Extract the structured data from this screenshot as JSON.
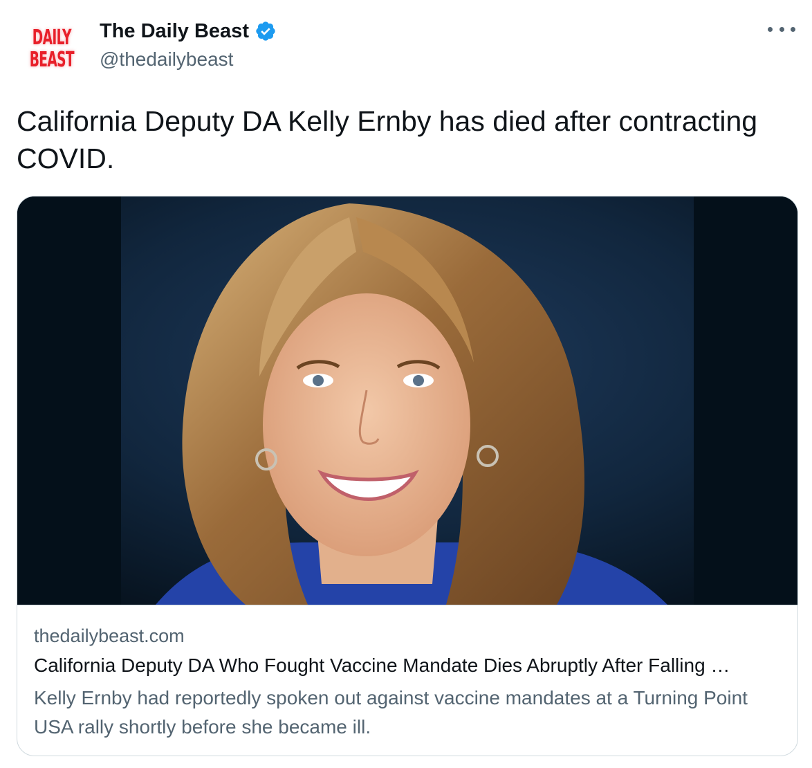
{
  "author": {
    "display_name": "The Daily Beast",
    "handle": "@thedailybeast",
    "verified": true,
    "avatar_logo": [
      "DAILY",
      "BEAST"
    ],
    "avatar_color": "#e8202a"
  },
  "tweet": {
    "text": "California Deputy DA Kelly Ernby has died after contracting COVID."
  },
  "link_card": {
    "domain": "thedailybeast.com",
    "title": "California Deputy DA Who Fought Vaccine Mandate Dies Abruptly After Falling …",
    "description": "Kelly Ernby had reportedly spoken out against vaccine mandates at a Turning Point USA rally shortly before she became ill.",
    "image_icon": "portrait-photo"
  },
  "icons": {
    "more": "more-icon",
    "verified": "verified-badge-icon"
  },
  "colors": {
    "text_primary": "#0f1419",
    "text_secondary": "#536471",
    "verified_blue": "#1d9bf0",
    "border": "#cfd9de"
  }
}
